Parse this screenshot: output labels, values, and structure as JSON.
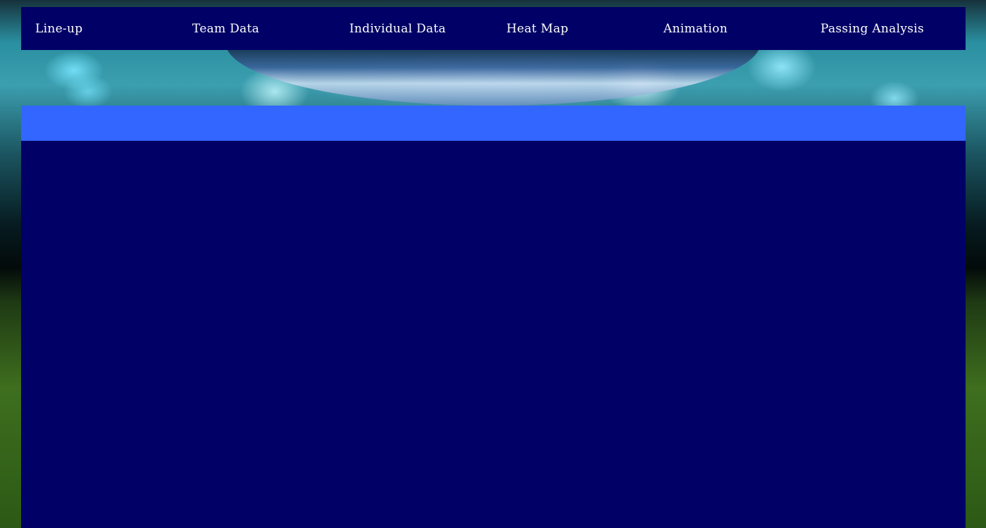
{
  "nav": {
    "items": [
      {
        "label": "Line-up"
      },
      {
        "label": "Team Data"
      },
      {
        "label": "Individual Data"
      },
      {
        "label": "Heat Map"
      },
      {
        "label": "Animation"
      },
      {
        "label": "Passing Analysis"
      }
    ]
  },
  "colors": {
    "nav_background": "#000066",
    "sub_bar": "#3366ff",
    "content_background": "#000066",
    "nav_text": "#ffffff"
  }
}
